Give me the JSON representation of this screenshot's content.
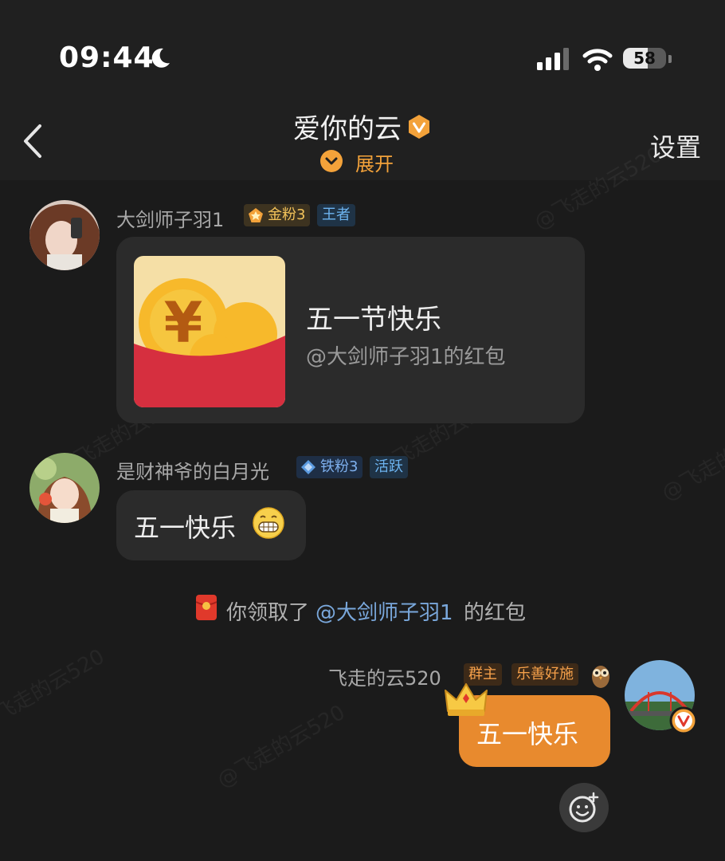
{
  "status_bar": {
    "time": "09:44",
    "battery": "58",
    "battery_level": 0.58
  },
  "nav": {
    "title": "爱你的云",
    "expand_label": "展开",
    "settings_label": "设置"
  },
  "watermark": "@飞走的云520",
  "messages": [
    {
      "sender": "大剑师子羽1",
      "tags": [
        "金粉3",
        "王者"
      ],
      "red_packet": {
        "title": "五一节快乐",
        "subtitle": "@大剑师子羽1的红包"
      }
    },
    {
      "sender": "是财神爷的白月光",
      "tags": [
        "铁粉3",
        "活跃"
      ],
      "text": "五一快乐"
    }
  ],
  "system_notice": {
    "prefix": "你领取了",
    "link": "@大剑师子羽1",
    "suffix": "的红包"
  },
  "my_message": {
    "sender": "飞走的云520",
    "tags": [
      "群主",
      "乐善好施"
    ],
    "text": "五一快乐"
  },
  "colors": {
    "accent": "#f3a23a",
    "bubble_mine": "#e88a2e",
    "link": "#7aa8dc",
    "background": "#1b1b1b"
  }
}
